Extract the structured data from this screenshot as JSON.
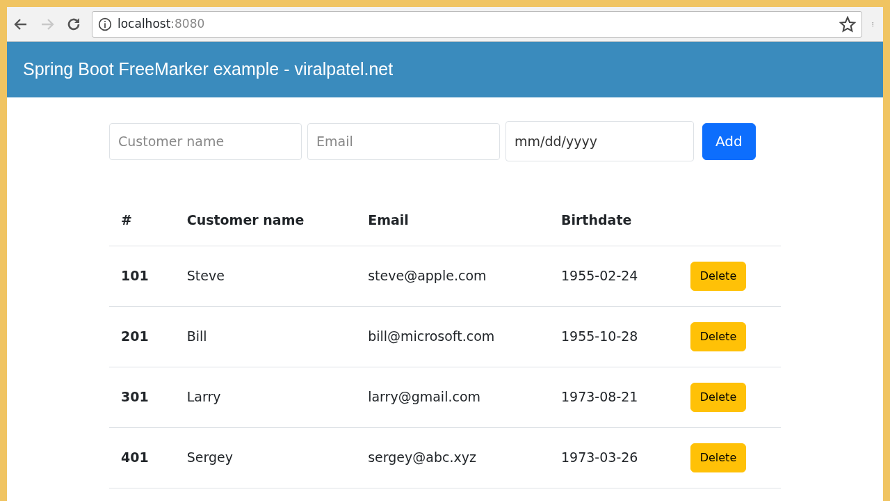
{
  "browser": {
    "url_host": "localhost",
    "url_port": ":8080",
    "forward_disabled": true
  },
  "navbar": {
    "title": "Spring Boot FreeMarker example - viralpatel.net"
  },
  "form": {
    "fields": [
      {
        "placeholder": "Customer name",
        "kind": "text"
      },
      {
        "placeholder": "Email",
        "kind": "text"
      },
      {
        "placeholder": "mm/dd/yyyy",
        "kind": "date"
      }
    ],
    "button": "Add"
  },
  "table": {
    "columns": [
      "#",
      "Customer name",
      "Email",
      "Birthdate"
    ],
    "rows": [
      {
        "id": "101",
        "name": "Steve",
        "email": "steve@apple.com",
        "birthdate": "1955-02-24",
        "action": "Delete"
      },
      {
        "id": "201",
        "name": "Bill",
        "email": "bill@microsoft.com",
        "birthdate": "1955-10-28",
        "action": "Delete"
      },
      {
        "id": "301",
        "name": "Larry",
        "email": "larry@gmail.com",
        "birthdate": "1973-08-21",
        "action": "Delete"
      },
      {
        "id": "401",
        "name": "Sergey",
        "email": "sergey@abc.xyz",
        "birthdate": "1973-03-26",
        "action": "Delete"
      }
    ]
  }
}
